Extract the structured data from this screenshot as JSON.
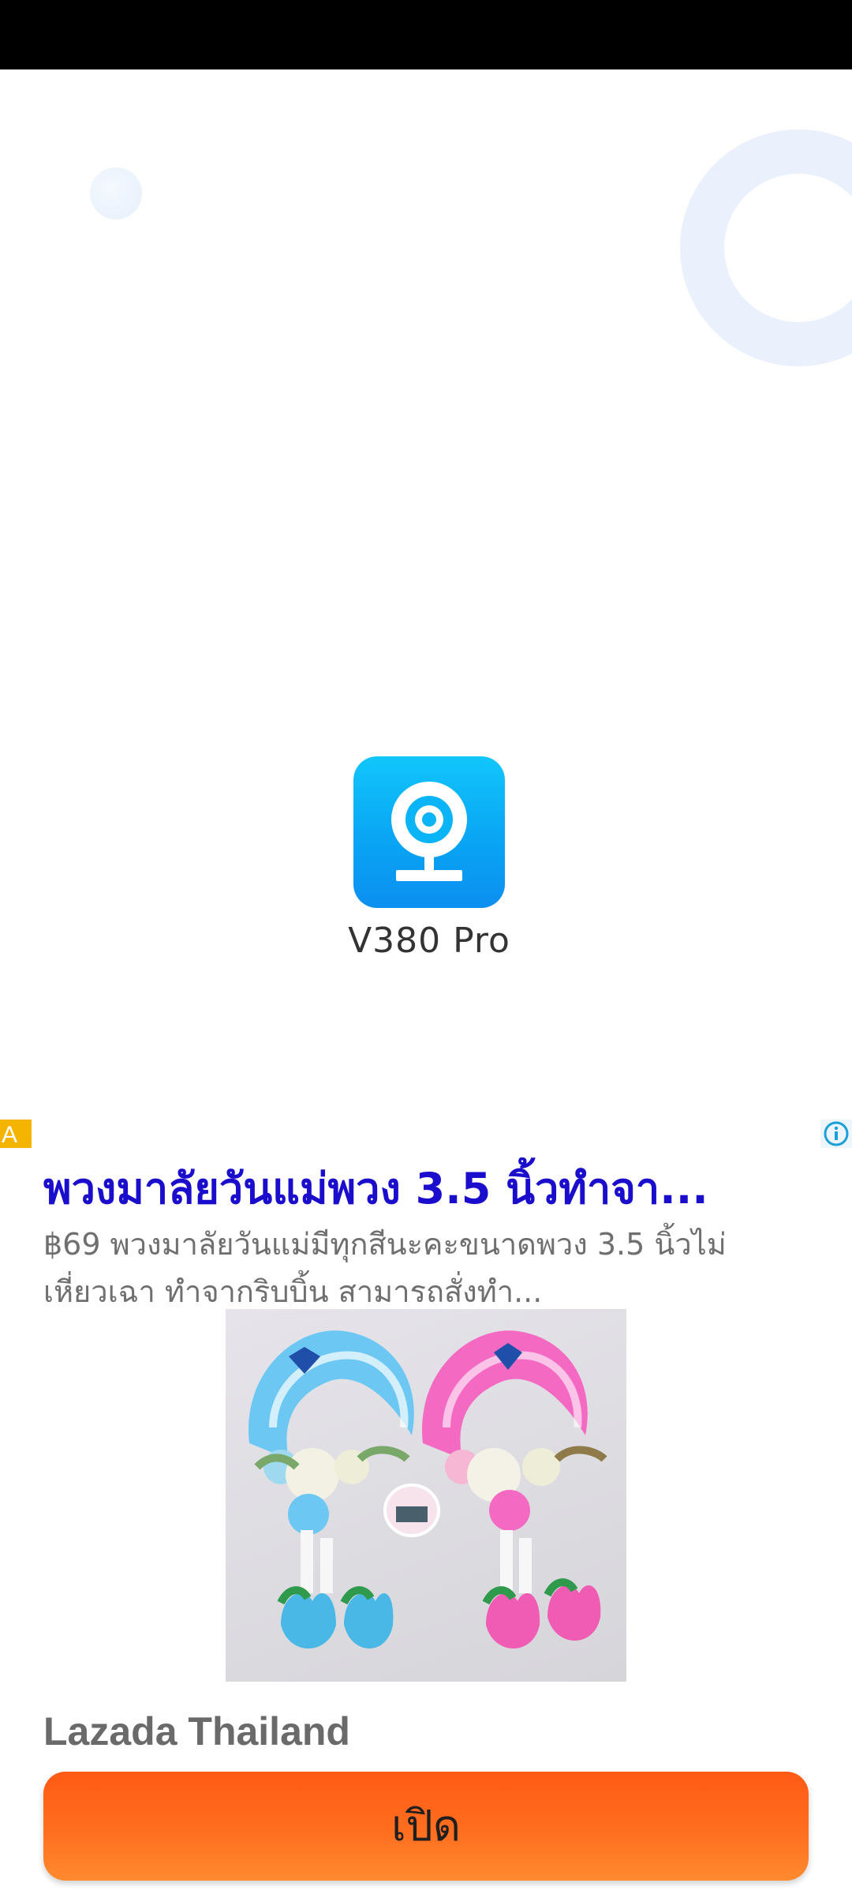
{
  "app": {
    "name": "V380 Pro",
    "icon": "webcam-icon",
    "icon_gradient": [
      "#11c6fb",
      "#0b8ff0"
    ]
  },
  "ad": {
    "badge_label": "A",
    "info_icon": "info-icon",
    "title": "พวงมาลัยวันแม่พวง 3.5 นิ้วทำจา...",
    "description_line1": "฿69 พวงมาลัยวันแม่มีทุกสีนะคะขนาดพวง 3.5 นิ้วไม่",
    "description_line2": "เหี่ยวเฉา ทำจากริบบิ้น สามารถสั่งทำ...",
    "advertiser": "Lazada Thailand",
    "cta_label": "เปิด",
    "colors": {
      "title": "#1a0dcc",
      "cta": "#ff6e1f",
      "badge": "#f4b400"
    }
  }
}
